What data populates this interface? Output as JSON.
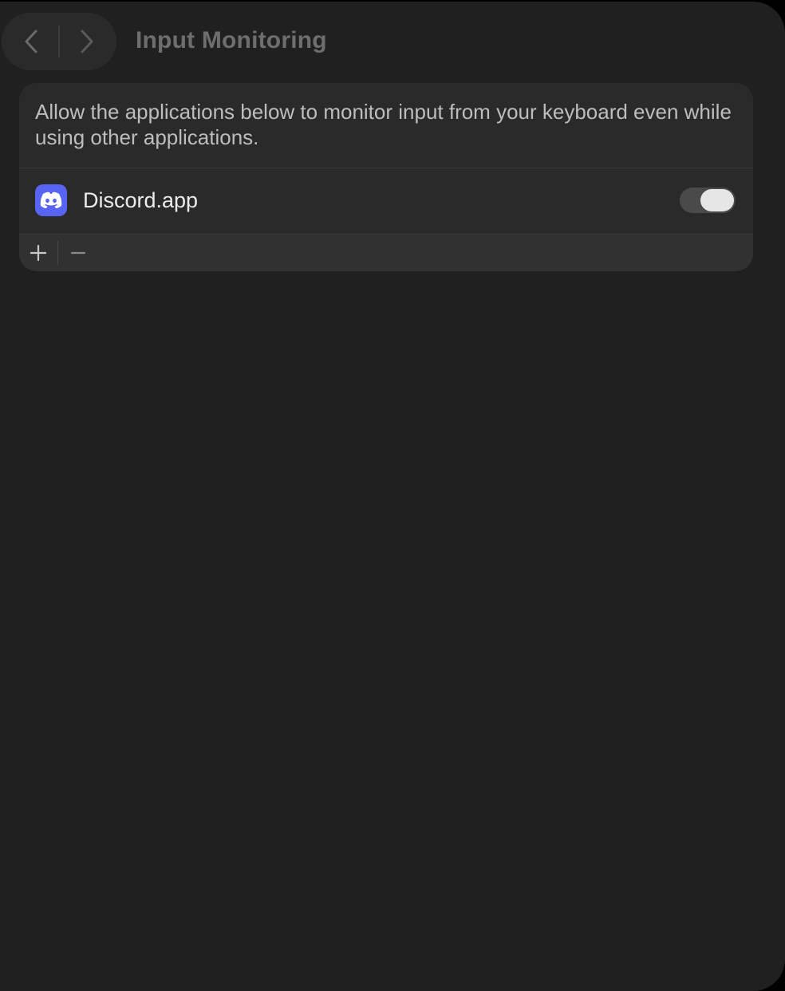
{
  "header": {
    "title": "Input Monitoring",
    "back_icon": "chevron-left-icon",
    "forward_icon": "chevron-right-icon"
  },
  "panel": {
    "description": "Allow the applications below to monitor input from your keyboard even while using other applications.",
    "apps": [
      {
        "name": "Discord.app",
        "icon": "discord-icon",
        "enabled": true
      }
    ],
    "footer": {
      "add_icon": "plus-icon",
      "remove_icon": "minus-icon"
    }
  },
  "colors": {
    "window_bg": "#202020",
    "card_bg": "#2a2a2a",
    "discord_brand": "#5865f2",
    "toggle_track": "#4a4a4a",
    "toggle_knob": "#e6e6e6"
  }
}
